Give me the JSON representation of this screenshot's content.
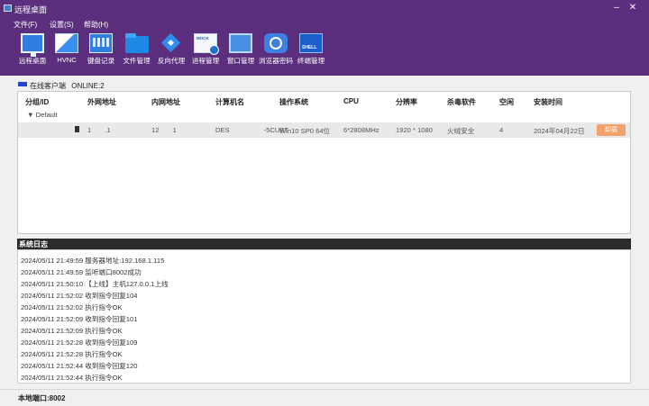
{
  "window": {
    "title": "远程桌面",
    "minimize": "–",
    "close": "✕",
    "icon": "app-icon"
  },
  "menu": [
    "文件(F)",
    "设置(S)",
    "帮助(H)"
  ],
  "toolbar": [
    {
      "label": "远程桌面",
      "icon": "remote-desktop-icon"
    },
    {
      "label": "HVNC",
      "icon": "hvnc-icon"
    },
    {
      "label": "键盘记录",
      "icon": "keyboard-log-icon"
    },
    {
      "label": "文件管理",
      "icon": "folder-icon"
    },
    {
      "label": "反向代理",
      "icon": "reverse-proxy-icon"
    },
    {
      "label": "进程管理",
      "icon": "process-icon"
    },
    {
      "label": "窗口管理",
      "icon": "window-icon"
    },
    {
      "label": "浏览器密码",
      "icon": "browser-password-icon"
    },
    {
      "label": "终端管理",
      "icon": "shell-icon"
    }
  ],
  "online": {
    "label": "在线客户端",
    "count_text": "ONLINE:2"
  },
  "table": {
    "headers": [
      "分组/ID",
      "外网地址",
      "内网地址",
      "计算机名",
      "操作系统",
      "CPU",
      "分辨率",
      "杀毒软件",
      "空闲",
      "安装时间"
    ],
    "group": "▼ Default",
    "rows": [
      {
        "external_ip": "1  .1",
        "internal_ip": "12  1",
        "computer_name": "DES     -5CUBT",
        "os": "Win10 SP0  64位",
        "cpu": "6*2808MHz",
        "resolution": "1920 * 1080",
        "antivirus": "火绒安全",
        "idle": "4",
        "install_time": "2024年04月22日",
        "action": "卸载"
      }
    ]
  },
  "log": {
    "title": "系统日志",
    "lines": [
      "2024/05/11 21:49:59 服务器地址:192.168.1.115",
      "2024/05/11 21:49:59 监听端口8002成功",
      "2024/05/11 21:50:10 【上线】主机127.0.0.1上线",
      "2024/05/11 21:52:02 收到指令回复104",
      "2024/05/11 21:52:02 执行指令OK",
      "2024/05/11 21:52:09 收到指令回复101",
      "2024/05/11 21:52:09 执行指令OK",
      "2024/05/11 21:52:28 收到指令回复109",
      "2024/05/11 21:52:28 执行指令OK",
      "2024/05/11 21:52:44 收到指令回复120",
      "2024/05/11 21:52:44 执行指令OK"
    ]
  },
  "status": {
    "text": "本地端口:8002"
  },
  "colors": {
    "brand": "#5b2e7e",
    "online_mark": "#2244cc",
    "uninstall": "#f2a36b"
  }
}
